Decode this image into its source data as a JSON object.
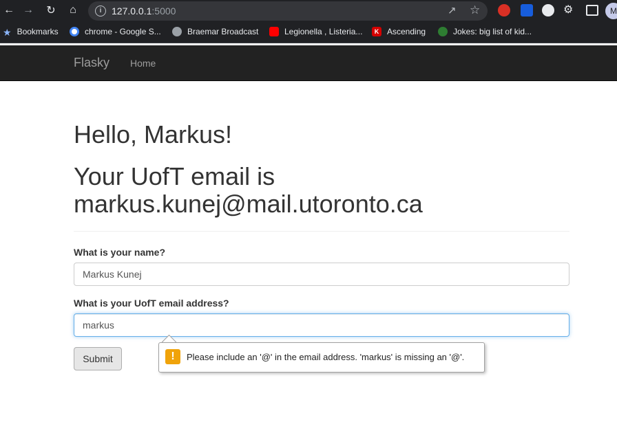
{
  "browser": {
    "url_host": "127.0.0.1",
    "url_port": ":5000",
    "profile_initial": "M",
    "bookmarks": [
      {
        "label": "Bookmarks",
        "icon": "star-icon"
      },
      {
        "label": "chrome - Google S...",
        "icon": "google-icon"
      },
      {
        "label": "Braemar Broadcast",
        "icon": "globe-icon"
      },
      {
        "label": "Legionella , Listeria...",
        "icon": "youtube-icon"
      },
      {
        "label": "Ascending",
        "icon": "k-icon"
      },
      {
        "label": "Jokes: big list of kid...",
        "icon": "d-icon"
      }
    ]
  },
  "navbar": {
    "brand": "Flasky",
    "home": "Home"
  },
  "page": {
    "greeting": "Hello, Markus!",
    "email_message": "Your UofT email is markus.kunej@mail.utoronto.ca"
  },
  "form": {
    "name_label": "What is your name?",
    "name_value": "Markus Kunej",
    "email_label": "What is your UofT email address?",
    "email_value": "markus",
    "submit_label": "Submit"
  },
  "validation": {
    "icon": "!",
    "message": "Please include an '@' in the email address. 'markus' is missing an '@'."
  },
  "colors": {
    "navbar_bg": "#222222",
    "focus_border": "#66afe9",
    "warning": "#f0a30a"
  }
}
